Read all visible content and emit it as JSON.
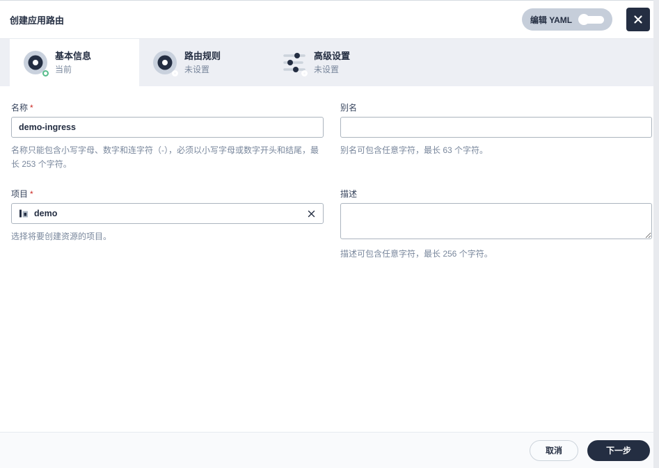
{
  "dialog": {
    "title": "创建应用路由"
  },
  "header": {
    "yaml_toggle_label": "编辑 YAML",
    "yaml_toggle_state": "off"
  },
  "steps": [
    {
      "label": "基本信息",
      "status": "当前",
      "state": "current"
    },
    {
      "label": "路由规则",
      "status": "未设置",
      "state": "unset"
    },
    {
      "label": "高级设置",
      "status": "未设置",
      "state": "unset"
    }
  ],
  "form": {
    "required_mark": "*",
    "name": {
      "label": "名称",
      "value": "demo-ingress",
      "help": "名称只能包含小写字母、数字和连字符（-），必须以小写字母或数字开头和结尾，最长 253 个字符。"
    },
    "alias": {
      "label": "别名",
      "value": "",
      "help": "别名可包含任意字符，最长 63 个字符。"
    },
    "project": {
      "label": "项目",
      "value": "demo",
      "help": "选择将要创建资源的项目。"
    },
    "description": {
      "label": "描述",
      "value": "",
      "help": "描述可包含任意字符，最长 256 个字符。"
    }
  },
  "footer": {
    "cancel_label": "取消",
    "next_label": "下一步"
  },
  "colors": {
    "accent_dark": "#242e42",
    "muted_text": "#79879c",
    "input_border": "#abb4be",
    "stepbar_bg": "#edeff4",
    "current_green": "#55bc8a",
    "required_red": "#ca2621",
    "footer_bg": "#f9fafc",
    "yaml_pill_bg": "#c6ceda"
  }
}
